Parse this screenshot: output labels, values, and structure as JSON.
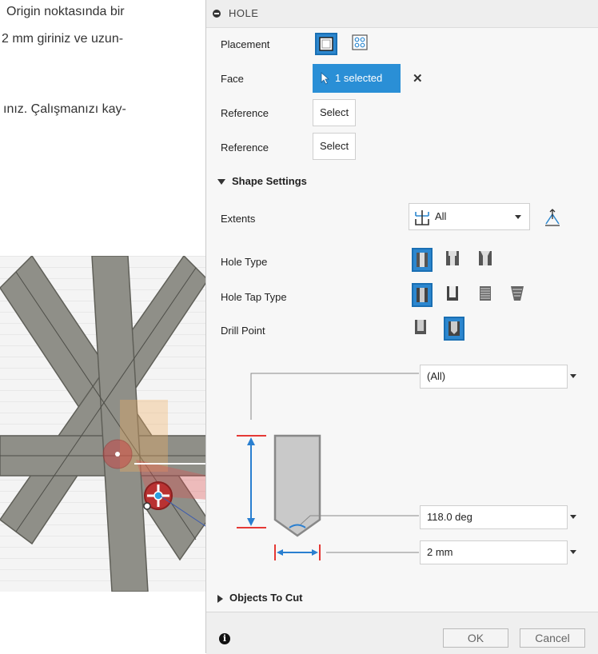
{
  "document": {
    "lines": [
      "Origin noktasında bir",
      "2 mm giriniz ve uzun-",
      "ınız. Çalışmanızı kay-"
    ]
  },
  "panel": {
    "title": "HOLE",
    "placement_label": "Placement",
    "face_label": "Face",
    "face_value": "1 selected",
    "face_clear": "✕",
    "reference1_label": "Reference",
    "reference1_value": "Select",
    "reference2_label": "Reference",
    "reference2_value": "Select",
    "shape_settings": "Shape Settings",
    "extents_label": "Extents",
    "extents_value": "All",
    "hole_type_label": "Hole Type",
    "hole_tap_type_label": "Hole Tap Type",
    "drill_point_label": "Drill Point",
    "depth_value": "(All)",
    "angle_value": "118.0 deg",
    "diameter_value": "2 mm",
    "objects_to_cut": "Objects To Cut",
    "ok_label": "OK",
    "cancel_label": "Cancel"
  },
  "colors": {
    "accent": "#2c87cf",
    "dim_red": "#e53935",
    "dim_blue": "#2a7fd0"
  }
}
